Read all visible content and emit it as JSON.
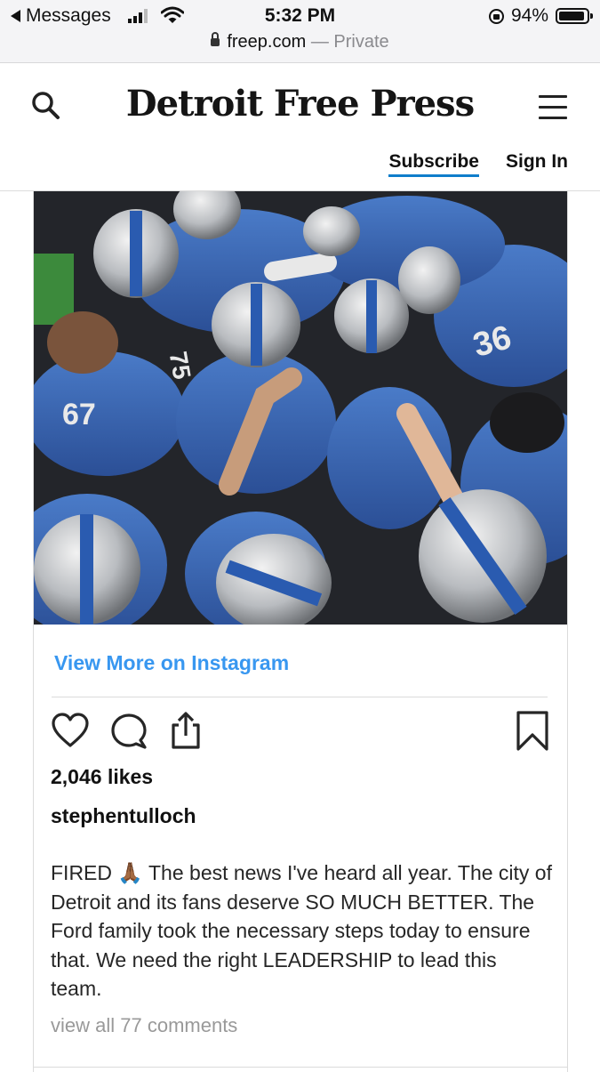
{
  "status_bar": {
    "back_app": "Messages",
    "time": "5:32 PM",
    "battery": "94%",
    "url": "freep.com",
    "url_suffix": " — Private",
    "icons": [
      "back-arrow-icon",
      "signal-bars-icon",
      "wifi-icon",
      "rotation-lock-icon",
      "battery-icon",
      "padlock-icon"
    ]
  },
  "header": {
    "logo": "Detroit Free Press",
    "subscribe": "Subscribe",
    "sign_in": "Sign In",
    "icons": [
      "search-icon",
      "hamburger-menu-icon"
    ],
    "accent_color": "#0f7ecb"
  },
  "embed": {
    "photo_desc_icon": "team-huddle-photo",
    "view_more": "View More on Instagram",
    "likes": "2,046 likes",
    "username": "stephentulloch",
    "caption_before_emoji": "FIRED ",
    "caption_emoji": "🙏🏾",
    "caption_after_emoji": " The best news I've heard all year. The city of Detroit and its fans deserve SO MUCH BETTER. The Ford family took the necessary steps today to ensure that. We need the right LEADERSHIP to lead this team.",
    "comments_link": "view all 77 comments",
    "link_color": "#3897f0",
    "action_icons": [
      "heart-icon",
      "comment-icon",
      "share-icon",
      "bookmark-icon"
    ]
  }
}
